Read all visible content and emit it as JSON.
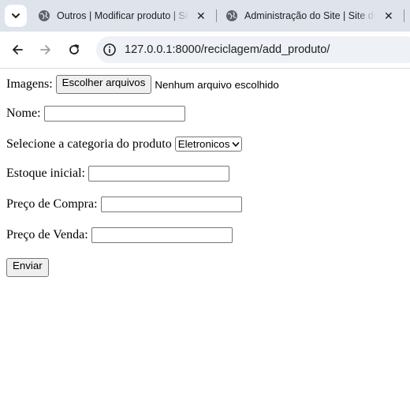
{
  "browser": {
    "tabs": [
      {
        "title": "Outros | Modificar produto | Site de Administração"
      },
      {
        "title": "Administração do Site | Site de Administração"
      }
    ],
    "address": "127.0.0.1:8000/reciclagem/add_produto/"
  },
  "form": {
    "images_label": "Imagens:",
    "file_button": "Escolher arquivos",
    "file_status": "Nenhum arquivo escolhido",
    "name_label": "Nome:",
    "name_value": "",
    "category_label": "Selecione a categoria do produto",
    "category_selected": "Eletronicos",
    "stock_label": "Estoque inicial:",
    "stock_value": "",
    "buy_price_label": "Preço de Compra:",
    "buy_price_value": "",
    "sell_price_label": "Preço de Venda:",
    "sell_price_value": "",
    "submit_label": "Enviar"
  }
}
